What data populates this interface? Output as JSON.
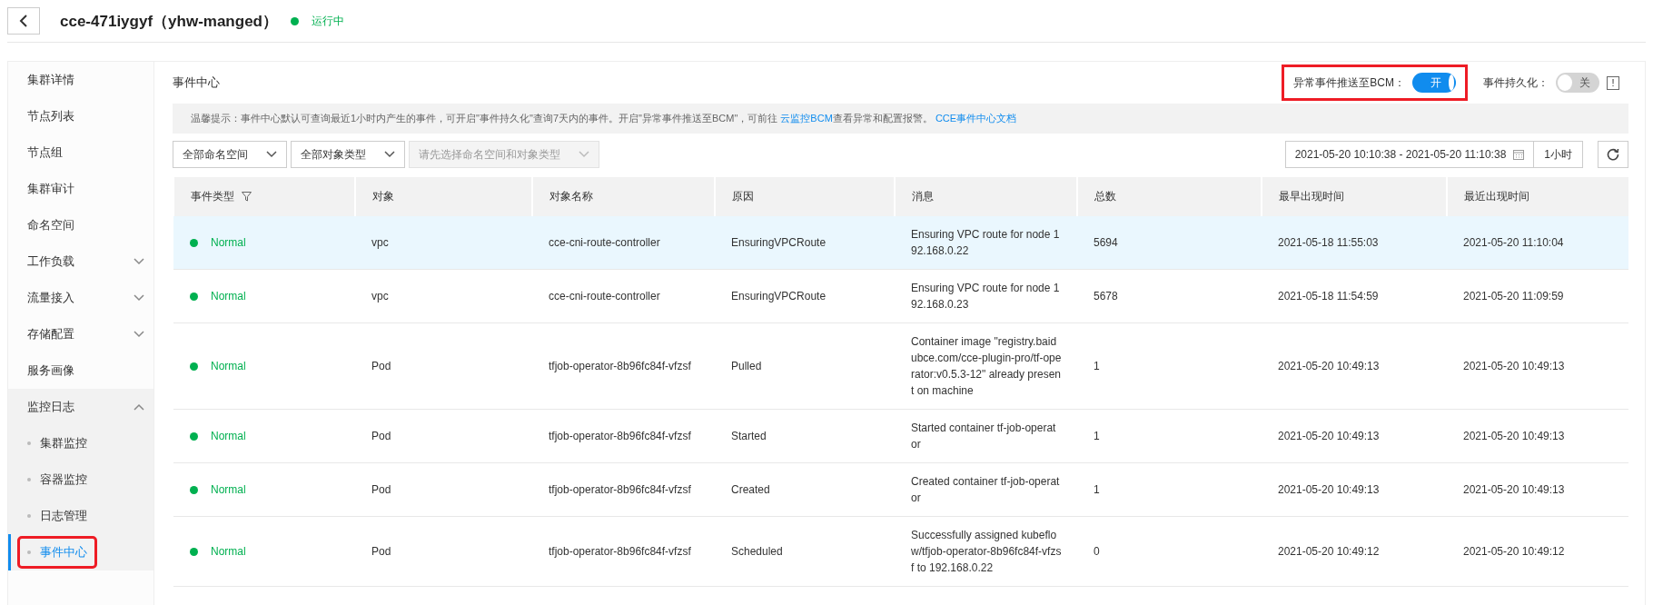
{
  "header": {
    "title": "cce-471iygyf（yhw-manged）",
    "status": {
      "label": "运行中",
      "color": "#00b050"
    }
  },
  "sidebar": {
    "items": [
      {
        "label": "集群详情",
        "selected": false
      },
      {
        "label": "节点列表",
        "selected": false
      },
      {
        "label": "节点组",
        "selected": false
      },
      {
        "label": "集群审计",
        "selected": false
      },
      {
        "label": "命名空间",
        "selected": false
      },
      {
        "label": "工作负载",
        "selected": false,
        "expanded": false
      },
      {
        "label": "流量接入",
        "selected": false,
        "expanded": false
      },
      {
        "label": "存储配置",
        "selected": false,
        "expanded": false
      },
      {
        "label": "服务画像",
        "selected": false
      },
      {
        "label": "监控日志",
        "selected": false,
        "expanded": true,
        "children": [
          {
            "label": "集群监控",
            "selected": false,
            "highlighted": false
          },
          {
            "label": "容器监控",
            "selected": false,
            "highlighted": false
          },
          {
            "label": "日志管理",
            "selected": false,
            "highlighted": false
          },
          {
            "label": "事件中心",
            "selected": true,
            "highlighted": true
          }
        ]
      }
    ]
  },
  "panel": {
    "title": "事件中心",
    "switches": [
      {
        "label": "异常事件推送至BCM：",
        "on": true,
        "text": "开",
        "highlighted": true
      },
      {
        "label": "事件持久化：",
        "on": false,
        "text": "关",
        "highlighted": false,
        "info": "!"
      }
    ],
    "hint": {
      "text": "温馨提示：事件中心默认可查询最近1小时内产生的事件，可开启\"事件持久化\"查询7天内的事件。开启\"异常事件推送至BCM\"，可前往 ",
      "link": "云监控BCM",
      "after": "查看异常和配置报警。 ",
      "doc_link": "CCE事件中心文档"
    },
    "filters": [
      {
        "value": "全部命名空间",
        "disabled": false
      },
      {
        "value": "全部对象类型",
        "disabled": false
      },
      {
        "placeholder": "请先选择命名空间和对象类型",
        "disabled": true
      }
    ],
    "time_range": {
      "value": "2021-05-20 10:10:38 - 2021-05-20 11:10:38",
      "quick": "1小时"
    },
    "table": {
      "columns": [
        "事件类型",
        "对象",
        "对象名称",
        "原因",
        "消息",
        "总数",
        "最早出现时间",
        "最近出现时间"
      ],
      "rows": [
        {
          "selected": true,
          "type": "Normal",
          "color": "#00b050",
          "object": "vpc",
          "name": "cce-cni-route-controller",
          "reason": "EnsuringVPCRoute",
          "message": "Ensuring VPC route for node 192.168.0.22",
          "count": "5694",
          "first": "2021-05-18 11:55:03",
          "last": "2021-05-20 11:10:04"
        },
        {
          "selected": false,
          "type": "Normal",
          "color": "#00b050",
          "object": "vpc",
          "name": "cce-cni-route-controller",
          "reason": "EnsuringVPCRoute",
          "message": "Ensuring VPC route for node 192.168.0.23",
          "count": "5678",
          "first": "2021-05-18 11:54:59",
          "last": "2021-05-20 11:09:59"
        },
        {
          "selected": false,
          "type": "Normal",
          "color": "#00b050",
          "object": "Pod",
          "name": "tfjob-operator-8b96fc84f-vfzsf",
          "reason": "Pulled",
          "message": "Container image \"registry.baidubce.com/cce-plugin-pro/tf-operator:v0.5.3-12\" already present on machine",
          "count": "1",
          "first": "2021-05-20 10:49:13",
          "last": "2021-05-20 10:49:13"
        },
        {
          "selected": false,
          "type": "Normal",
          "color": "#00b050",
          "object": "Pod",
          "name": "tfjob-operator-8b96fc84f-vfzsf",
          "reason": "Started",
          "message": "Started container tf-job-operator",
          "count": "1",
          "first": "2021-05-20 10:49:13",
          "last": "2021-05-20 10:49:13"
        },
        {
          "selected": false,
          "type": "Normal",
          "color": "#00b050",
          "object": "Pod",
          "name": "tfjob-operator-8b96fc84f-vfzsf",
          "reason": "Created",
          "message": "Created container tf-job-operator",
          "count": "1",
          "first": "2021-05-20 10:49:13",
          "last": "2021-05-20 10:49:13"
        },
        {
          "selected": false,
          "type": "Normal",
          "color": "#00b050",
          "object": "Pod",
          "name": "tfjob-operator-8b96fc84f-vfzsf",
          "reason": "Scheduled",
          "message": "Successfully assigned kubeflow/tfjob-operator-8b96fc84f-vfzsf to 192.168.0.22",
          "count": "0",
          "first": "2021-05-20 10:49:12",
          "last": "2021-05-20 10:49:12"
        }
      ]
    }
  }
}
